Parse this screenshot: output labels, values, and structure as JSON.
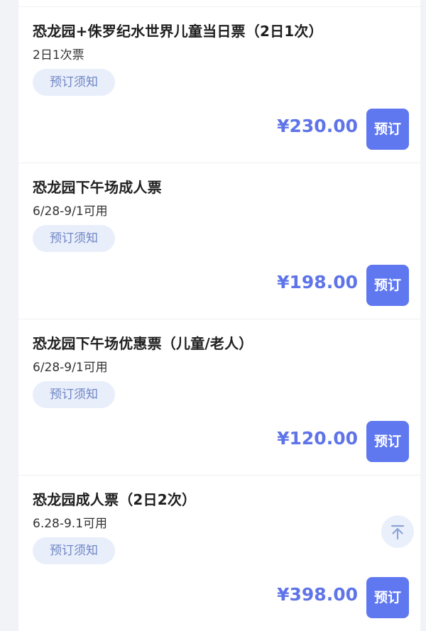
{
  "tickets": [
    {
      "title": "恐龙园+侏罗纪水世界儿童当日票（2日1次）",
      "desc": "2日1次票",
      "notice_label": "预订须知",
      "price": "¥230.00",
      "book_label": "预订"
    },
    {
      "title": "恐龙园下午场成人票",
      "desc": "6/28-9/1可用",
      "notice_label": "预订须知",
      "price": "¥198.00",
      "book_label": "预订"
    },
    {
      "title": "恐龙园下午场优惠票（儿童/老人）",
      "desc": "6/28-9/1可用",
      "notice_label": "预订须知",
      "price": "¥120.00",
      "book_label": "预订"
    },
    {
      "title": "恐龙园成人票（2日2次）",
      "desc": "6.28-9.1可用",
      "notice_label": "预订须知",
      "price": "¥398.00",
      "book_label": "预订"
    }
  ],
  "floating": {
    "back_to_top_icon": "arrow-up-to-top-icon"
  },
  "colors": {
    "accent": "#5f78f0",
    "price": "#5e74e8",
    "notice_bg": "#e9eefb",
    "notice_text": "#6f86c5"
  }
}
